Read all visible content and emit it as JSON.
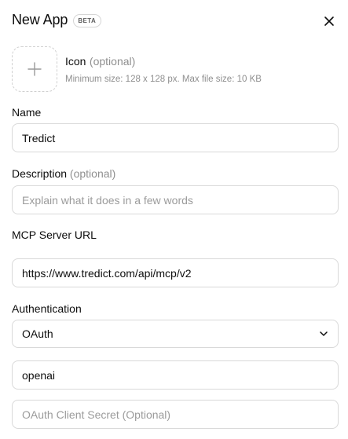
{
  "header": {
    "title": "New App",
    "badge": "BETA"
  },
  "icon_section": {
    "label": "Icon",
    "optional": "(optional)",
    "hint": "Minimum size: 128 x 128 px. Max file size: 10 KB"
  },
  "name": {
    "label": "Name",
    "value": "Tredict"
  },
  "description": {
    "label": "Description",
    "optional": "(optional)",
    "value": "",
    "placeholder": "Explain what it does in a few words"
  },
  "mcp": {
    "label": "MCP Server URL",
    "value": "https://www.tredict.com/api/mcp/v2"
  },
  "authentication": {
    "label": "Authentication",
    "selected": "OAuth"
  },
  "client_id": {
    "value": "openai"
  },
  "client_secret": {
    "value": "",
    "placeholder": "OAuth Client Secret (Optional)"
  },
  "icons": {
    "close": "close-icon",
    "upload": "plus-icon",
    "dropdown": "chevron-down-icon"
  }
}
